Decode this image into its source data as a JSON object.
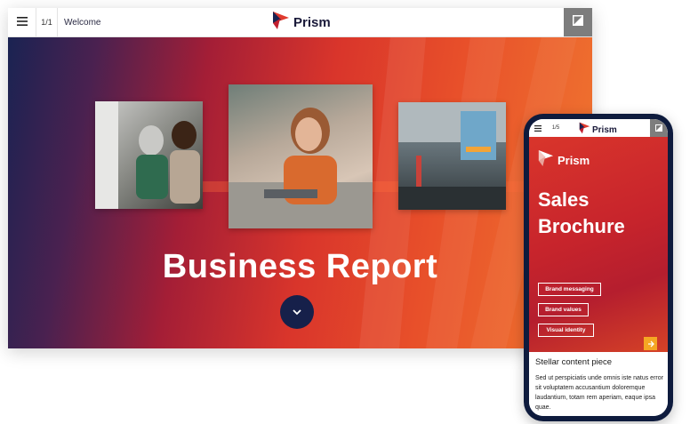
{
  "desktop": {
    "page_indicator": "1/1",
    "title": "Welcome",
    "logo_text": "Prism",
    "headline": "Business Report",
    "photos": [
      "two-people-at-computer",
      "woman-on-sofa-with-laptop",
      "exhibition-hall"
    ]
  },
  "phone": {
    "page_indicator": "1/5",
    "logo_text": "Prism",
    "brand_text": "Prism",
    "headline_line1": "Sales",
    "headline_line2": "Brochure",
    "buttons": [
      "Brand messaging",
      "Brand values",
      "Visual identity"
    ],
    "card_title": "Stellar content piece",
    "card_text": "Sed ut perspiciatis unde omnis iste natus error sit voluptatem accusantium doloremque laudantium, totam rem aperiam, eaque ipsa quae."
  },
  "colors": {
    "navy": "#16204a",
    "red": "#c7242c",
    "orange": "#f07830",
    "accent_yellow": "#f5a623",
    "corner_gray": "#7d7d7d"
  },
  "icons": [
    "menu-icon",
    "prism-logo-icon",
    "expand-corner-icon",
    "chevron-down-icon",
    "arrow-right-icon"
  ]
}
